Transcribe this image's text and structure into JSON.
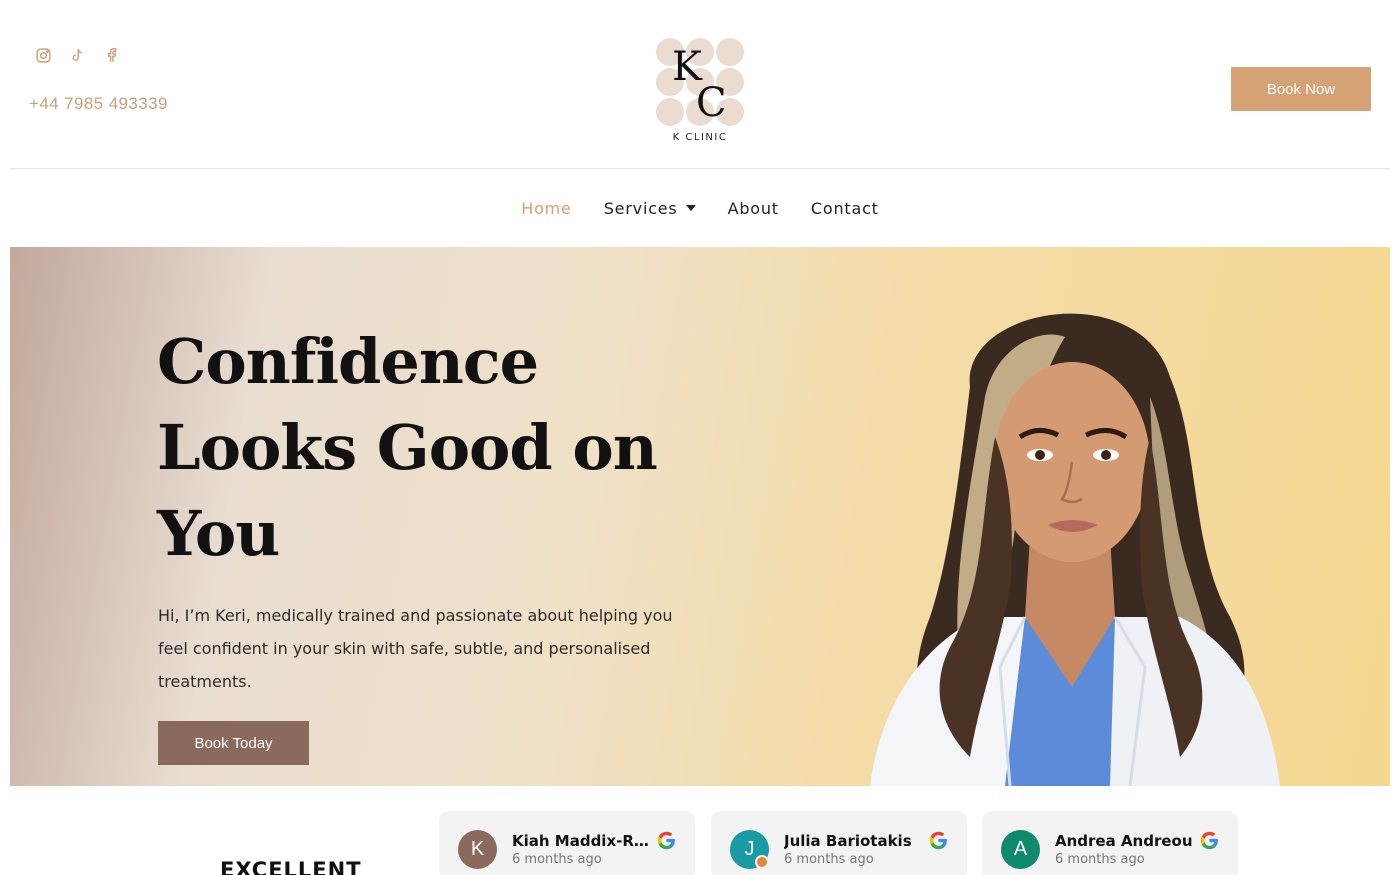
{
  "header": {
    "social": [
      {
        "icon": "instagram-icon"
      },
      {
        "icon": "tiktok-icon"
      },
      {
        "icon": "facebook-icon"
      }
    ],
    "phone": "+44 7985 493339",
    "logo": {
      "monogram_k": "K",
      "monogram_c": "C",
      "text": "K CLINIC"
    },
    "book_now_label": "Book Now"
  },
  "nav": {
    "items": [
      {
        "label": "Home",
        "active": true
      },
      {
        "label": "Services",
        "has_dropdown": true
      },
      {
        "label": "About"
      },
      {
        "label": "Contact"
      }
    ]
  },
  "hero": {
    "title_lines": [
      "Confidence",
      "Looks Good on",
      "You"
    ],
    "description": "Hi, I’m Keri, medically trained and passionate about helping you feel confident in your skin with safe, subtle, and personalised treatments.",
    "cta_label": "Book Today"
  },
  "reviews": {
    "rating_label": "EXCELLENT",
    "items": [
      {
        "initial": "K",
        "name": "Kiah Maddix-Re...",
        "time": "6 months ago",
        "avatar_color": "#8b6a5e"
      },
      {
        "initial": "J",
        "name": "Julia Bariotakis",
        "time": "6 months ago",
        "avatar_color": "#1a9aa5"
      },
      {
        "initial": "A",
        "name": "Andrea Andreou",
        "time": "6 months ago",
        "avatar_color": "#0f8a6e"
      }
    ]
  },
  "colors": {
    "accent": "#d4a274",
    "cta_dark": "#8b6a5e",
    "logo_circles": "#eadcd1"
  }
}
